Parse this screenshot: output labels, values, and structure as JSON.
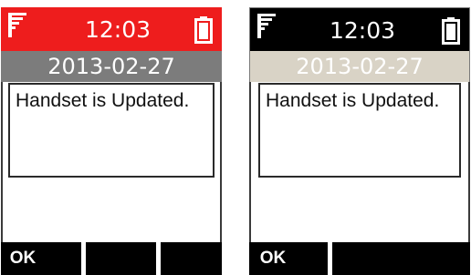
{
  "screens": [
    {
      "theme": "red",
      "status": {
        "time": "12:03",
        "signal_icon": "signal-icon",
        "battery_icon": "battery-icon",
        "background_color": "#ee1d1d"
      },
      "date": "2013-02-27",
      "message": "Handset is Updated.",
      "softkeys": {
        "left": "OK",
        "middle": "",
        "right": ""
      }
    },
    {
      "theme": "black",
      "status": {
        "time": "12:03",
        "signal_icon": "signal-icon",
        "battery_icon": "battery-icon",
        "background_color": "#000000"
      },
      "date": "2013-02-27",
      "message": "Handset is Updated.",
      "softkeys": {
        "left": "OK",
        "right": ""
      }
    }
  ]
}
